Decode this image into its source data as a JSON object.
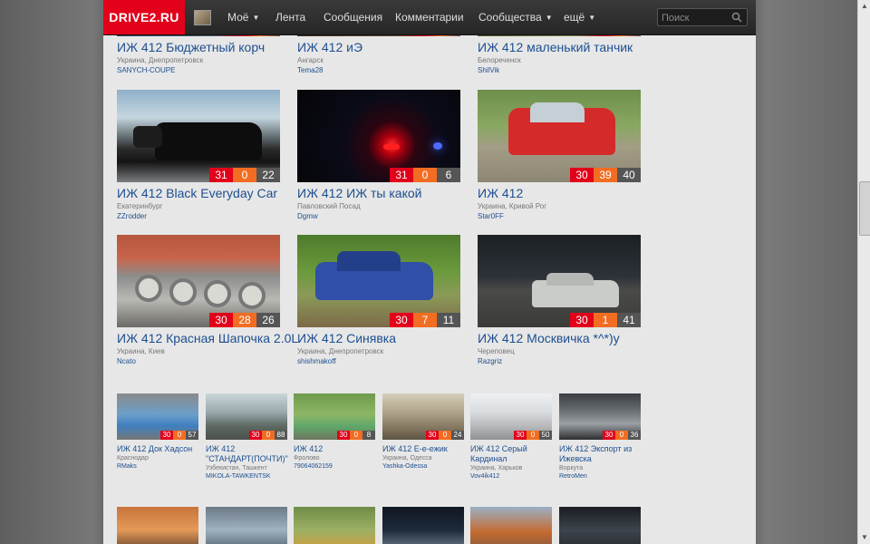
{
  "nav": {
    "logo": "DRIVE2.RU",
    "items": [
      {
        "label": "Моё",
        "caret": "▼"
      },
      {
        "label": "Лента"
      },
      {
        "label": "Сообщения"
      },
      {
        "label": "Комментарии"
      },
      {
        "label": "Сообщества",
        "caret": "▼"
      },
      {
        "label": "ещё",
        "caret": "▼"
      }
    ],
    "search_placeholder": "Поиск"
  },
  "colors": {
    "accent": "#e2001a",
    "orange": "#f26d22",
    "link": "#1d4f90"
  },
  "big_cards": [
    {
      "title": "ИЖ 412 Бюджетный корч",
      "location": "Украина, Днепропетровск",
      "user": "SANYCH-COUPE"
    },
    {
      "title": "ИЖ 412 иЭ",
      "location": "Ангарск",
      "user": "Tema28"
    },
    {
      "title": "ИЖ 412 маленький танчик",
      "location": "Белореченск",
      "user": "ShilVik"
    },
    {
      "title": "ИЖ 412 Black Everyday Car",
      "location": "Екатеринбург",
      "user": "ZZrodder",
      "stats": [
        "31",
        "0",
        "22"
      ]
    },
    {
      "title": "ИЖ 412 ИЖ ты какой",
      "location": "Павловский Посад",
      "user": "Dgmw",
      "stats": [
        "31",
        "0",
        "6"
      ]
    },
    {
      "title": "ИЖ 412",
      "location": "Украина, Кривой Рог",
      "user": "Star0FF",
      "stats": [
        "30",
        "39",
        "40"
      ]
    },
    {
      "title": "ИЖ 412 Красная Шапочка 2.0L",
      "location": "Украина, Киев",
      "user": "Ncato",
      "stats": [
        "30",
        "28",
        "26"
      ]
    },
    {
      "title": "ИЖ 412 Синявка",
      "location": "Украина, Днепропетровск",
      "user": "shishmakoff",
      "stats": [
        "30",
        "7",
        "11"
      ]
    },
    {
      "title": "ИЖ 412 Москвичка *^*)у",
      "location": "Череповец",
      "user": "Razgriz",
      "stats": [
        "30",
        "1",
        "41"
      ]
    }
  ],
  "small_cards": [
    {
      "title": "ИЖ 412 Док Хадсон",
      "location": "Краснодар",
      "user": "RMaks",
      "stats": [
        "30",
        "0",
        "57"
      ]
    },
    {
      "title": "ИЖ 412 \"СТАНДАРТ(ПОЧТИ)\"",
      "location": "Узбекистан, Ташкент",
      "user": "MIKOLA-TAWKENTSK",
      "stats": [
        "30",
        "0",
        "88"
      ]
    },
    {
      "title": "ИЖ 412",
      "location": "Фролово",
      "user": "79064062159",
      "stats": [
        "30",
        "0",
        "8"
      ]
    },
    {
      "title": "ИЖ 412 Е-е-ежик",
      "location": "Украина, Одесса",
      "user": "Yashka-Odessa",
      "stats": [
        "30",
        "0",
        "24"
      ]
    },
    {
      "title": "ИЖ 412 Серый Кардинал",
      "location": "Украина, Харьков",
      "user": "Vov4ik412",
      "stats": [
        "30",
        "0",
        "50"
      ]
    },
    {
      "title": "ИЖ 412 Экспорт из Ижевска",
      "location": "Воркута",
      "user": "RetroMen",
      "stats": [
        "30",
        "0",
        "36"
      ]
    }
  ]
}
